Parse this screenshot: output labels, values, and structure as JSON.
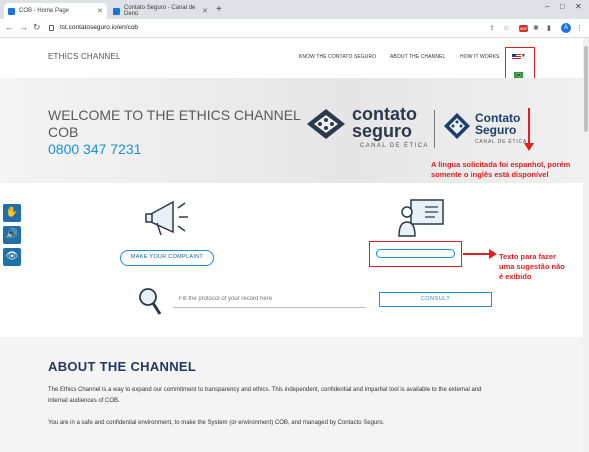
{
  "browser": {
    "tabs": [
      {
        "title": "COB - Home Page",
        "active": true
      },
      {
        "title": "Contato Seguro - Canal de Denú",
        "active": false
      }
    ],
    "url": "tst.contatoseguro.io/en/cob",
    "profile_initial": "A",
    "ext_badge": "ABP"
  },
  "header": {
    "logo_text": "ETHICS CHANNEL",
    "nav": [
      "KNOW THE CONTATO SEGURO",
      "ABOUT THE CHANNEL",
      "HOW IT WORKS"
    ],
    "language_options": [
      "us-flag",
      "br-flag",
      "us-flag"
    ]
  },
  "hero": {
    "title": "WELCOME TO THE ETHICS CHANNEL",
    "subtitle": "COB",
    "phone": "0800 347 7231",
    "brand_name_line1": "contato",
    "brand_name_line2": "seguro",
    "brand_tagline": "CANAL DE ÉTICA",
    "brand2_line1": "Contato",
    "brand2_line2": "Seguro",
    "brand2_tagline": "CANAL DE ÉTICA"
  },
  "annotations": {
    "language_note_line1": "A língua solicitada foi espanhol, porém",
    "language_note_line2": "somente o inglês está disponível",
    "suggestion_note_line1": "Texto para fazer",
    "suggestion_note_line2": "uma sugestão não",
    "suggestion_note_line3": "é exibido"
  },
  "actions": {
    "complaint_button": "MAKE YOUR COMPLAINT",
    "suggestion_button": "",
    "protocol_placeholder": "Fill the protocol of your record here",
    "consult_button": "CONSULT"
  },
  "about": {
    "title": "ABOUT THE CHANNEL",
    "paragraph1_line1": "The Ethics Channel is a way to expand our commitment to transparency and ethics. This independent, confidential and impartial tool is available to the external and",
    "paragraph1_line2": "internal audiences of COB.",
    "paragraph2": "You are in a safe and confidential environment, to make the System (or environment) COB, and managed by Contacto Seguro."
  },
  "colors": {
    "accent_blue": "#1e90d8",
    "annotation_red": "#e02020",
    "accessibility_blue": "#1f6fa8",
    "navy": "#1f3a5f"
  }
}
